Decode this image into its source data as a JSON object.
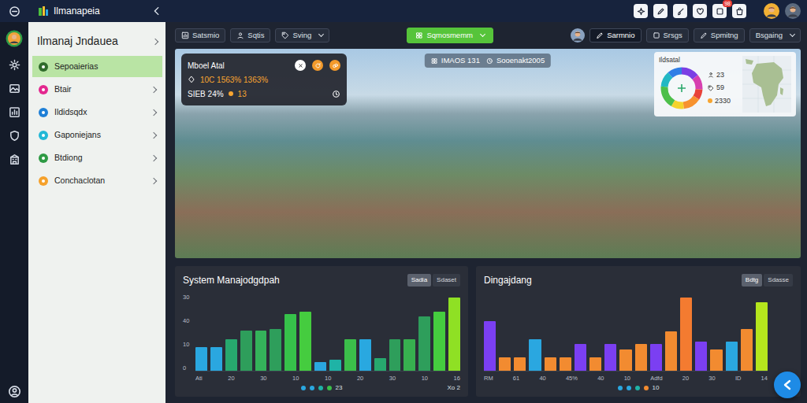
{
  "topbar": {
    "title": "Ilmanapeia",
    "badge": "98"
  },
  "sidebar": {
    "title": "Ilmanaj Jndauea",
    "items": [
      {
        "label": "Sepoaierias",
        "selected": true,
        "expandable": false,
        "color": "#2f6b2a"
      },
      {
        "label": "Btair",
        "selected": false,
        "expandable": true,
        "color": "#e3288f"
      },
      {
        "label": "Ildidsqdx",
        "selected": false,
        "expandable": true,
        "color": "#1e7fd6"
      },
      {
        "label": "Gaponiejans",
        "selected": false,
        "expandable": true,
        "color": "#22b8d6"
      },
      {
        "label": "Btdiong",
        "selected": false,
        "expandable": true,
        "color": "#2e9a44"
      },
      {
        "label": "Conchaclotan",
        "selected": false,
        "expandable": true,
        "color": "#f5a12b"
      }
    ]
  },
  "toolbar": {
    "left": [
      {
        "label": "Satsmio",
        "dropdown": false
      },
      {
        "label": "Sqtis",
        "dropdown": false
      },
      {
        "label": "Sving",
        "dropdown": true
      }
    ],
    "primary": {
      "label": "Sqmosmemm",
      "dropdown": true
    },
    "right": [
      {
        "label": "Sarmnio",
        "selected": true,
        "dropdown": false
      },
      {
        "label": "Srsgs",
        "selected": false,
        "dropdown": false
      },
      {
        "label": "Spmitng",
        "selected": false,
        "dropdown": false
      },
      {
        "label": "Bsgaing",
        "selected": false,
        "dropdown": true
      }
    ]
  },
  "hero": {
    "info": {
      "title": "Mboel Atal",
      "metrics": "10C 1563% 1363%",
      "status": "SIEB 24%",
      "count": "13"
    },
    "pills": [
      "IMAOS 131",
      "Sooenakt2005"
    ],
    "widget": {
      "title": "Ildsatal",
      "stats": [
        "23",
        "59"
      ],
      "total": "2330",
      "donut": [
        {
          "value": 14,
          "color": "#7b3fe4"
        },
        {
          "value": 12,
          "color": "#d63fb0"
        },
        {
          "value": 8,
          "color": "#e8423a"
        },
        {
          "value": 14,
          "color": "#f7922f"
        },
        {
          "value": 10,
          "color": "#f5d32b"
        },
        {
          "value": 18,
          "color": "#4cbf4a"
        },
        {
          "value": 12,
          "color": "#22b8c4"
        },
        {
          "value": 12,
          "color": "#2f7ee6"
        }
      ]
    }
  },
  "charts": [
    {
      "title": "System Manajodgdpah",
      "tabs": [
        {
          "label": "Sadia",
          "selected": true
        },
        {
          "label": "Sdaset",
          "selected": false
        }
      ],
      "y_ticks": [
        "30",
        "40",
        "10",
        "0"
      ],
      "x_labels": [
        "Ati",
        "20",
        "30",
        "10",
        "10",
        "20",
        "30",
        "10",
        "16"
      ],
      "values": [
        11,
        11,
        15,
        19,
        19,
        20,
        27,
        28,
        4,
        5,
        15,
        15,
        6,
        15,
        15,
        26,
        28,
        35
      ],
      "colors": [
        "#2aa7e0",
        "#2aa7e0",
        "#27a86e",
        "#2e9e5b",
        "#34b35a",
        "#2e9e5b",
        "#36c24a",
        "#45cc3f",
        "#2aa7e0",
        "#1fb3a6",
        "#3bbf4a",
        "#29a8e0",
        "#27a86e",
        "#2e9e5b",
        "#37b04f",
        "#2e9e5b",
        "#45cc3f",
        "#8fe024"
      ],
      "legend": {
        "colors": [
          "#2aa7e0",
          "#2aa7e0",
          "#1fb3a6",
          "#3bbf4a"
        ],
        "label": "23"
      },
      "footer": "Xo 2"
    },
    {
      "title": "Dingajdang",
      "tabs": [
        {
          "label": "Bdtg",
          "selected": true
        },
        {
          "label": "Sdasse",
          "selected": false
        }
      ],
      "x_labels": [
        "RM",
        "61",
        "40",
        "45%",
        "40",
        "10",
        "Adfd",
        "20",
        "30",
        "ID",
        "14"
      ],
      "values": [
        19,
        5,
        5,
        12,
        5,
        5,
        10,
        5,
        10,
        8,
        10,
        10,
        15,
        28,
        11,
        8,
        11,
        16,
        26
      ],
      "colors": [
        "#7b3ff2",
        "#f28b30",
        "#f28b30",
        "#2aa7e0",
        "#f28b30",
        "#f28b30",
        "#7b3ff2",
        "#f28b30",
        "#7b3ff2",
        "#f28b30",
        "#f28b30",
        "#7b3ff2",
        "#f28b30",
        "#f47b30",
        "#7b3ff2",
        "#f28b30",
        "#2aa7e0",
        "#f28b30",
        "#b5e61d"
      ],
      "legend": {
        "colors": [
          "#2aa7e0",
          "#2aa7e0",
          "#1fb3a6",
          "#f28b30"
        ],
        "label": "10"
      }
    }
  ]
}
